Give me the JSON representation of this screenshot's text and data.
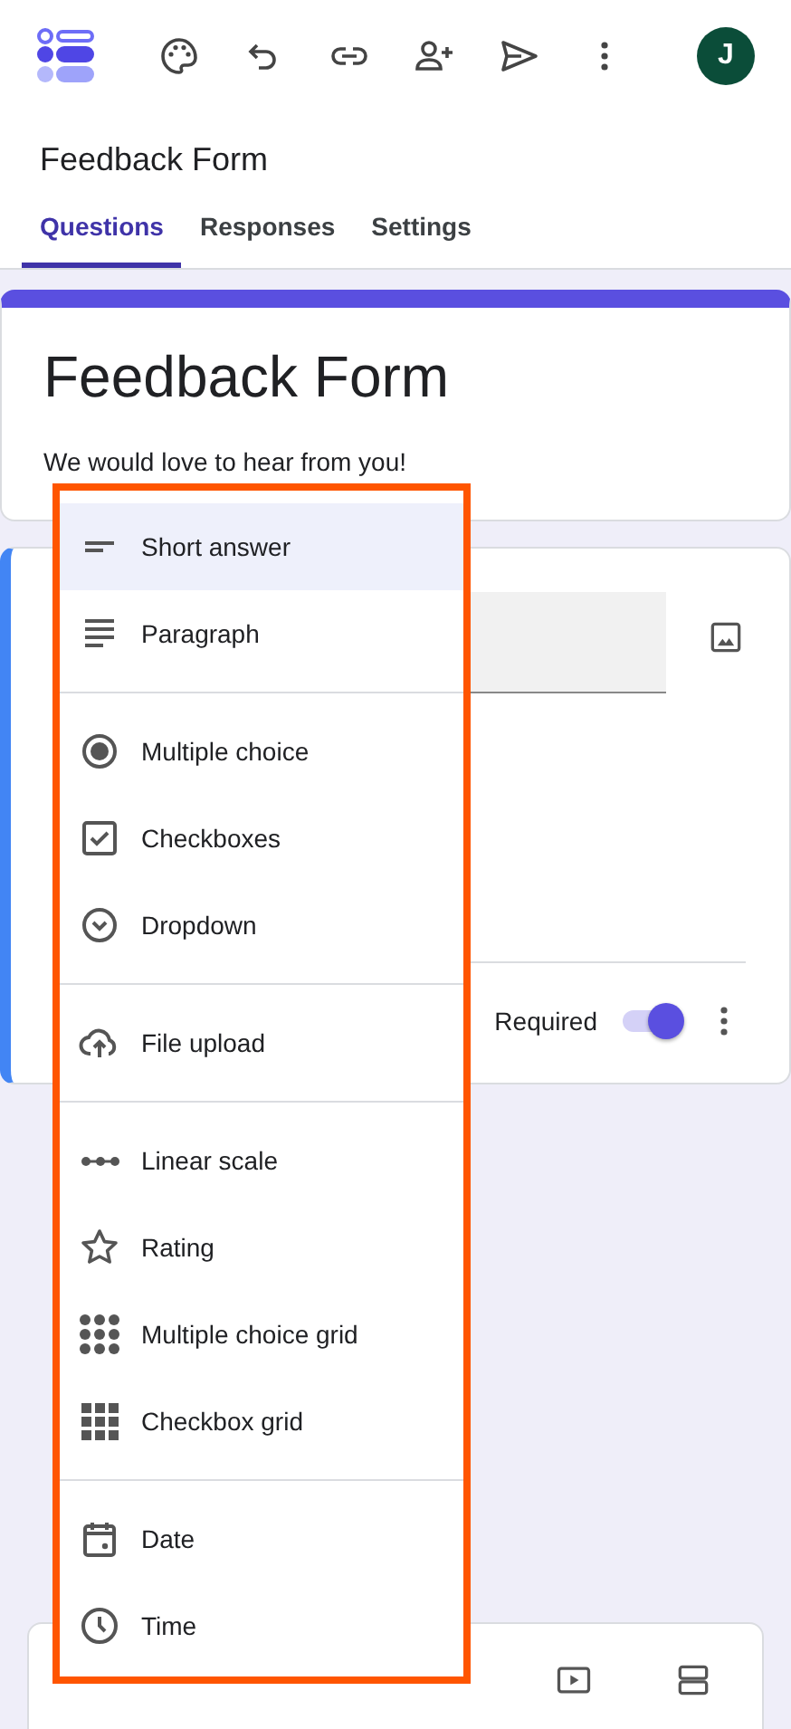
{
  "app_bar": {
    "avatar_initial": "J"
  },
  "form_name": "Feedback Form",
  "tabs": [
    {
      "label": "Questions",
      "selected": true
    },
    {
      "label": "Responses",
      "selected": false
    },
    {
      "label": "Settings",
      "selected": false
    }
  ],
  "header": {
    "title": "Feedback Form",
    "description": "We would love to hear from you!"
  },
  "question": {
    "required_label": "Required",
    "required_on": true
  },
  "type_menu": [
    [
      {
        "kind": "short",
        "label": "Short answer",
        "selected": true
      },
      {
        "kind": "paragraph",
        "label": "Paragraph",
        "selected": false
      }
    ],
    [
      {
        "kind": "radio",
        "label": "Multiple choice",
        "selected": false
      },
      {
        "kind": "checkbox",
        "label": "Checkboxes",
        "selected": false
      },
      {
        "kind": "dropdown",
        "label": "Dropdown",
        "selected": false
      }
    ],
    [
      {
        "kind": "upload",
        "label": "File upload",
        "selected": false
      }
    ],
    [
      {
        "kind": "scale",
        "label": "Linear scale",
        "selected": false
      },
      {
        "kind": "star",
        "label": "Rating",
        "selected": false
      },
      {
        "kind": "dotgrid",
        "label": "Multiple choice grid",
        "selected": false
      },
      {
        "kind": "squaregrid",
        "label": "Checkbox grid",
        "selected": false
      }
    ],
    [
      {
        "kind": "date",
        "label": "Date",
        "selected": false
      },
      {
        "kind": "time",
        "label": "Time",
        "selected": false
      }
    ]
  ]
}
